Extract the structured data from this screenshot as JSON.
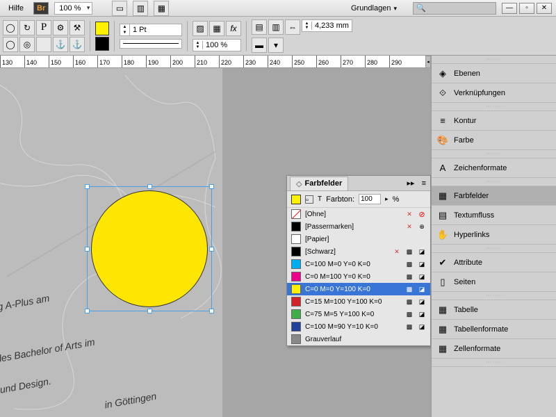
{
  "menubar": {
    "help": "Hilfe",
    "br": "Br",
    "zoom": "100 %",
    "workspace": "Grundlagen"
  },
  "toolbar": {
    "stroke_pt": "1 Pt",
    "scale_pct": "100 %",
    "measure": "4,233 mm"
  },
  "ruler": {
    "start": 130,
    "end": 290,
    "step": 10
  },
  "canvas_text": {
    "t1": "eig A-Plus am",
    "t2": "Grades Bachelor of Arts im",
    "t3": "on und Design.",
    "t4": "in Göttingen"
  },
  "swatches": {
    "title": "Farbfelder",
    "tint_label": "Farbton:",
    "tint_value": "100",
    "tint_suffix": "%",
    "rows": [
      {
        "name": "[Ohne]",
        "color": "none",
        "x": true,
        "locked": true
      },
      {
        "name": "[Passermarken]",
        "color": "#000",
        "x": true,
        "reg": true
      },
      {
        "name": "[Papier]",
        "color": "#fff"
      },
      {
        "name": "[Schwarz]",
        "color": "#000",
        "x": true,
        "proc": true
      },
      {
        "name": "C=100 M=0 Y=0 K=0",
        "color": "#00adee",
        "proc": true
      },
      {
        "name": "C=0 M=100 Y=0 K=0",
        "color": "#ec008c",
        "proc": true
      },
      {
        "name": "C=0 M=0 Y=100 K=0",
        "color": "#fff200",
        "proc": true,
        "sel": true
      },
      {
        "name": "C=15 M=100 Y=100 K=0",
        "color": "#d2232a",
        "proc": true
      },
      {
        "name": "C=75 M=5 Y=100 K=0",
        "color": "#3fae49",
        "proc": true
      },
      {
        "name": "C=100 M=90 Y=10 K=0",
        "color": "#21409a",
        "proc": true
      },
      {
        "name": "Grauverlauf",
        "color": "#888"
      }
    ]
  },
  "panels": {
    "items": [
      {
        "label": "Ebenen",
        "icon": "◈"
      },
      {
        "label": "Verknüpfungen",
        "icon": "⟐"
      }
    ],
    "items2": [
      {
        "label": "Kontur",
        "icon": "≡"
      },
      {
        "label": "Farbe",
        "icon": "🎨"
      }
    ],
    "items3": [
      {
        "label": "Zeichenformate",
        "icon": "A"
      }
    ],
    "items4": [
      {
        "label": "Farbfelder",
        "icon": "▦",
        "active": true
      },
      {
        "label": "Textumfluss",
        "icon": "▤"
      },
      {
        "label": "Hyperlinks",
        "icon": "✋"
      }
    ],
    "items5": [
      {
        "label": "Attribute",
        "icon": "✔"
      },
      {
        "label": "Seiten",
        "icon": "▯"
      }
    ],
    "items6": [
      {
        "label": "Tabelle",
        "icon": "▦"
      },
      {
        "label": "Tabellenformate",
        "icon": "▦"
      },
      {
        "label": "Zellenformate",
        "icon": "▦"
      }
    ]
  }
}
